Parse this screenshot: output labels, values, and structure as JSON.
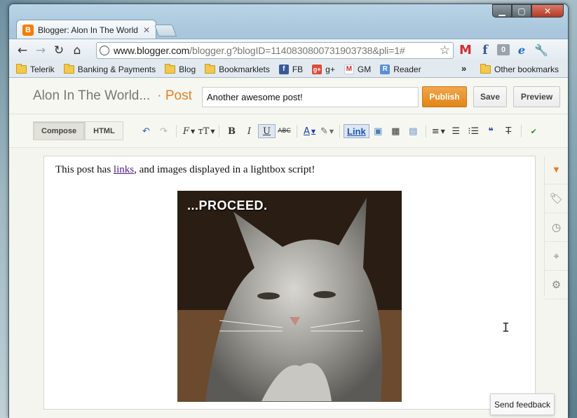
{
  "browser": {
    "tab": {
      "title": "Blogger: Alon In The World",
      "favicon": "blogger-icon"
    },
    "url": {
      "host": "www.blogger.com",
      "path": "/blogger.g?blogID=1140830800731903738&pli=1#"
    },
    "extensions": {
      "count_badge": "0"
    },
    "bookmarks": [
      {
        "label": "Telerik",
        "icon": "folder-icon"
      },
      {
        "label": "Banking & Payments",
        "icon": "folder-icon"
      },
      {
        "label": "Blog",
        "icon": "folder-icon"
      },
      {
        "label": "Bookmarklets",
        "icon": "folder-icon"
      },
      {
        "label": "FB",
        "icon": "facebook-icon"
      },
      {
        "label": "g+",
        "icon": "google-plus-icon"
      },
      {
        "label": "GM",
        "icon": "gmail-icon"
      },
      {
        "label": "Reader",
        "icon": "reader-icon"
      }
    ],
    "other_bookmarks": "Other bookmarks"
  },
  "blogger": {
    "blog_title": "Alon In The World...",
    "crumb": "· Post",
    "post_title": "Another awesome post!",
    "publish_label": "Publish",
    "save_label": "Save",
    "preview_label": "Preview",
    "compose_label": "Compose",
    "html_label": "HTML",
    "link_label": "Link",
    "accent_color": "#e67e22"
  },
  "post": {
    "text_before": "This post has ",
    "link_text": "links",
    "text_after": ", and images displayed in a lightbox script!",
    "image_caption": "...PROCEED."
  },
  "feedback_label": "Send feedback"
}
